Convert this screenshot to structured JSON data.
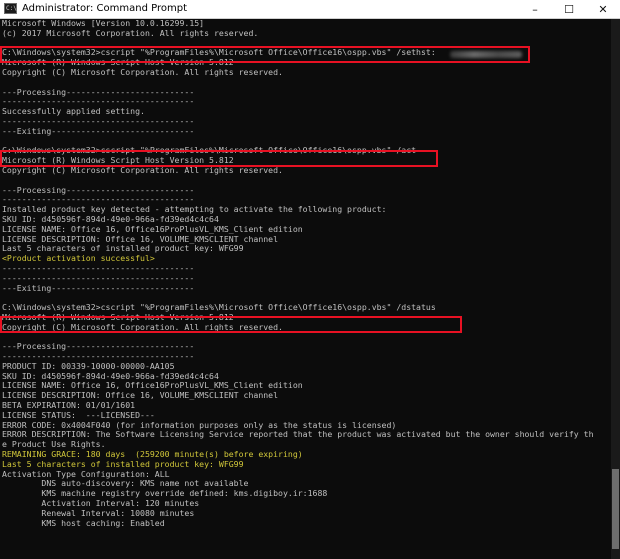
{
  "window": {
    "title": "Administrator: Command Prompt",
    "icon": "cmd-icon",
    "minimize_icon": "–",
    "maximize_icon": "☐",
    "close_icon": "✕"
  },
  "colors": {
    "background": "#0c0c0c",
    "text": "#c0c0c0",
    "highlight_text": "#d1c73a",
    "annotation_box": "#e81123"
  },
  "console_lines": [
    {
      "text": "Microsoft Windows [Version 10.0.16299.15]",
      "color": "default"
    },
    {
      "text": "(c) 2017 Microsoft Corporation. All rights reserved.",
      "color": "default"
    },
    {
      "text": "",
      "color": "default"
    },
    {
      "text": "C:\\Windows\\system32>cscript \"%ProgramFiles%\\Microsoft Office\\Office16\\ospp.vbs\" /sethst:",
      "color": "default"
    },
    {
      "text": "Microsoft (R) Windows Script Host Version 5.812",
      "color": "default"
    },
    {
      "text": "Copyright (C) Microsoft Corporation. All rights reserved.",
      "color": "default"
    },
    {
      "text": "",
      "color": "default"
    },
    {
      "text": "---Processing--------------------------",
      "color": "default"
    },
    {
      "text": "---------------------------------------",
      "color": "default"
    },
    {
      "text": "Successfully applied setting.",
      "color": "default"
    },
    {
      "text": "---------------------------------------",
      "color": "default"
    },
    {
      "text": "---Exiting-----------------------------",
      "color": "default"
    },
    {
      "text": "",
      "color": "default"
    },
    {
      "text": "C:\\Windows\\system32>cscript \"%ProgramFiles%\\Microsoft Office\\Office16\\ospp.vbs\" /act",
      "color": "default"
    },
    {
      "text": "Microsoft (R) Windows Script Host Version 5.812",
      "color": "default"
    },
    {
      "text": "Copyright (C) Microsoft Corporation. All rights reserved.",
      "color": "default"
    },
    {
      "text": "",
      "color": "default"
    },
    {
      "text": "---Processing--------------------------",
      "color": "default"
    },
    {
      "text": "---------------------------------------",
      "color": "default"
    },
    {
      "text": "Installed product key detected - attempting to activate the following product:",
      "color": "default"
    },
    {
      "text": "SKU ID: d450596f-894d-49e0-966a-fd39ed4c4c64",
      "color": "default"
    },
    {
      "text": "LICENSE NAME: Office 16, Office16ProPlusVL_KMS_Client edition",
      "color": "default"
    },
    {
      "text": "LICENSE DESCRIPTION: Office 16, VOLUME_KMSCLIENT channel",
      "color": "default"
    },
    {
      "text": "Last 5 characters of installed product key: WFG99",
      "color": "default"
    },
    {
      "text": "<Product activation successful>",
      "color": "yellow"
    },
    {
      "text": "---------------------------------------",
      "color": "default"
    },
    {
      "text": "---------------------------------------",
      "color": "default"
    },
    {
      "text": "---Exiting-----------------------------",
      "color": "default"
    },
    {
      "text": "",
      "color": "default"
    },
    {
      "text": "C:\\Windows\\system32>cscript \"%ProgramFiles%\\Microsoft Office\\Office16\\ospp.vbs\" /dstatus",
      "color": "default"
    },
    {
      "text": "Microsoft (R) Windows Script Host Version 5.812",
      "color": "default"
    },
    {
      "text": "Copyright (C) Microsoft Corporation. All rights reserved.",
      "color": "default"
    },
    {
      "text": "",
      "color": "default"
    },
    {
      "text": "---Processing--------------------------",
      "color": "default"
    },
    {
      "text": "---------------------------------------",
      "color": "default"
    },
    {
      "text": "PRODUCT ID: 00339-10000-00000-AA105",
      "color": "default"
    },
    {
      "text": "SKU ID: d450596f-894d-49e0-966a-fd39ed4c4c64",
      "color": "default"
    },
    {
      "text": "LICENSE NAME: Office 16, Office16ProPlusVL_KMS_Client edition",
      "color": "default"
    },
    {
      "text": "LICENSE DESCRIPTION: Office 16, VOLUME_KMSCLIENT channel",
      "color": "default"
    },
    {
      "text": "BETA EXPIRATION: 01/01/1601",
      "color": "default"
    },
    {
      "text": "LICENSE STATUS:  ---LICENSED---",
      "color": "default"
    },
    {
      "text": "ERROR CODE: 0x4004F040 (for information purposes only as the status is licensed)",
      "color": "default"
    },
    {
      "text": "ERROR DESCRIPTION: The Software Licensing Service reported that the product was activated but the owner should verify th",
      "color": "default"
    },
    {
      "text": "e Product Use Rights.",
      "color": "default"
    },
    {
      "text": "REMAINING GRACE: 180 days  (259200 minute(s) before expiring)",
      "color": "yellow"
    },
    {
      "text": "Last 5 characters of installed product key: WFG99",
      "color": "yellow"
    },
    {
      "text": "Activation Type Configuration: ALL",
      "color": "default"
    },
    {
      "text": "        DNS auto-discovery: KMS name not available",
      "color": "default"
    },
    {
      "text": "        KMS machine registry override defined: kms.digiboy.ir:1688",
      "color": "default"
    },
    {
      "text": "        Activation Interval: 120 minutes",
      "color": "default"
    },
    {
      "text": "        Renewal Interval: 10080 minutes",
      "color": "default"
    },
    {
      "text": "        KMS host caching: Enabled",
      "color": "default"
    }
  ]
}
